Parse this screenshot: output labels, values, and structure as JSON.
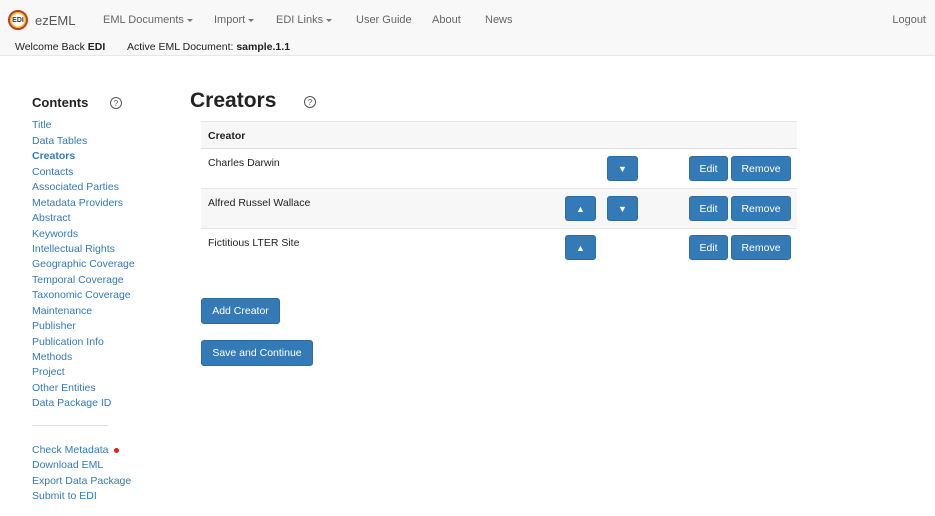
{
  "brand": {
    "logo_text": "EDI",
    "name": "ezEML"
  },
  "nav": {
    "items": [
      {
        "label": "EML Documents",
        "dropdown": true
      },
      {
        "label": "Import",
        "dropdown": true
      },
      {
        "label": "EDI Links",
        "dropdown": true
      },
      {
        "label": "User Guide",
        "dropdown": false
      },
      {
        "label": "About",
        "dropdown": false
      },
      {
        "label": "News",
        "dropdown": false
      }
    ],
    "logout": "Logout"
  },
  "status": {
    "welcome_prefix": "Welcome Back",
    "user": "EDI",
    "active_prefix": "Active EML Document:",
    "active_doc": "sample.1.1"
  },
  "sidebar": {
    "title": "Contents",
    "help": "?",
    "items": [
      "Title",
      "Data Tables",
      "Creators",
      "Contacts",
      "Associated Parties",
      "Metadata Providers",
      "Abstract",
      "Keywords",
      "Intellectual Rights",
      "Geographic Coverage",
      "Temporal Coverage",
      "Taxonomic Coverage",
      "Maintenance",
      "Publisher",
      "Publication Info",
      "Methods",
      "Project",
      "Other Entities",
      "Data Package ID"
    ],
    "active": "Creators",
    "actions": [
      "Check Metadata",
      "Download EML",
      "Export Data Package",
      "Submit to EDI"
    ],
    "colors": {
      "link": "#337ab7",
      "alert_dot": "#e0201b"
    }
  },
  "main": {
    "title": "Creators",
    "help": "?",
    "column_header": "Creator",
    "rows": [
      {
        "name": "Charles Darwin",
        "up": false,
        "down": true
      },
      {
        "name": "Alfred Russel Wallace",
        "up": true,
        "down": true
      },
      {
        "name": "Fictitious LTER Site",
        "up": true,
        "down": false
      }
    ],
    "up_glyph": "▲",
    "down_glyph": "▼",
    "edit_label": "Edit",
    "remove_label": "Remove",
    "add_label": "Add Creator",
    "save_label": "Save and Continue",
    "colors": {
      "button": "#337ab7"
    }
  }
}
